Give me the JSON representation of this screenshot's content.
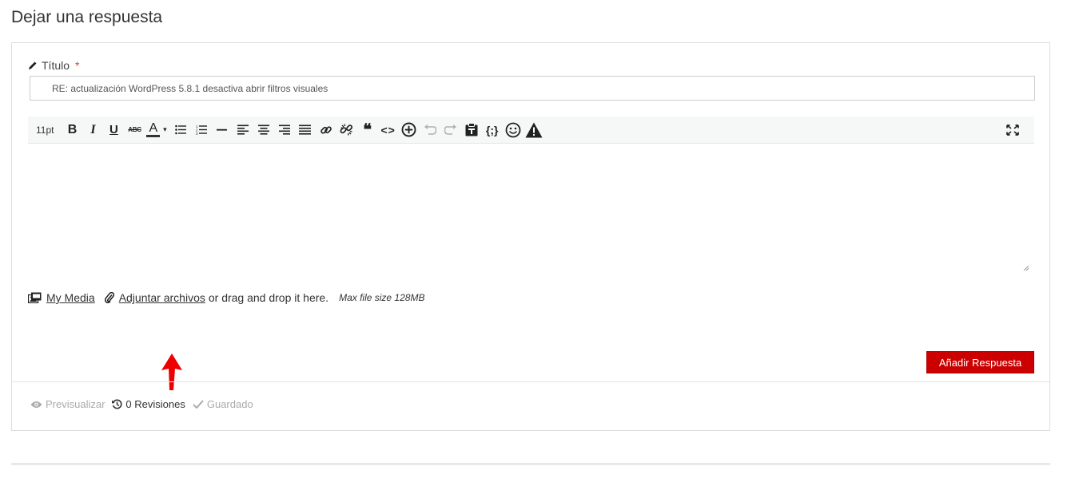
{
  "page": {
    "title": "Dejar una respuesta"
  },
  "form": {
    "title_label": "Título",
    "required_mark": "*",
    "title_value": "RE: actualización WordPress 5.8.1 desactiva abrir filtros visuales"
  },
  "toolbar": {
    "font_size": "11pt",
    "bold_glyph": "B",
    "italic_glyph": "I",
    "underline_glyph": "U",
    "strike_glyph": "ABC",
    "color_glyph": "A",
    "color_caret": "▾",
    "quote_glyph": "❝",
    "code_glyph": "<>",
    "code_sample_glyph": "{;}",
    "icons": [
      "bold-icon",
      "italic-icon",
      "underline-icon",
      "strikethrough-icon",
      "text-color-icon",
      "bullet-list-icon",
      "numbered-list-icon",
      "horizontal-rule-icon",
      "align-left-icon",
      "align-center-icon",
      "align-right-icon",
      "align-justify-icon",
      "link-icon",
      "unlink-icon",
      "blockquote-icon",
      "code-icon",
      "insert-icon",
      "undo-icon",
      "redo-icon",
      "paste-text-icon",
      "code-sample-icon",
      "emoticon-icon",
      "spoiler-icon",
      "fullscreen-icon"
    ]
  },
  "attachments": {
    "my_media": "My Media",
    "attach_files": "Adjuntar archivos",
    "drag_drop": "or drag and drop it here.",
    "max_size": "Max file size 128MB"
  },
  "actions": {
    "submit": "Añadir Respuesta"
  },
  "footer": {
    "preview": "Previsualizar",
    "revisions": "0 Revisiones",
    "saved": "Guardado"
  },
  "colors": {
    "submit_bg": "#cc0000",
    "arrow": "#ee0000",
    "muted": "#aaaaaa"
  }
}
